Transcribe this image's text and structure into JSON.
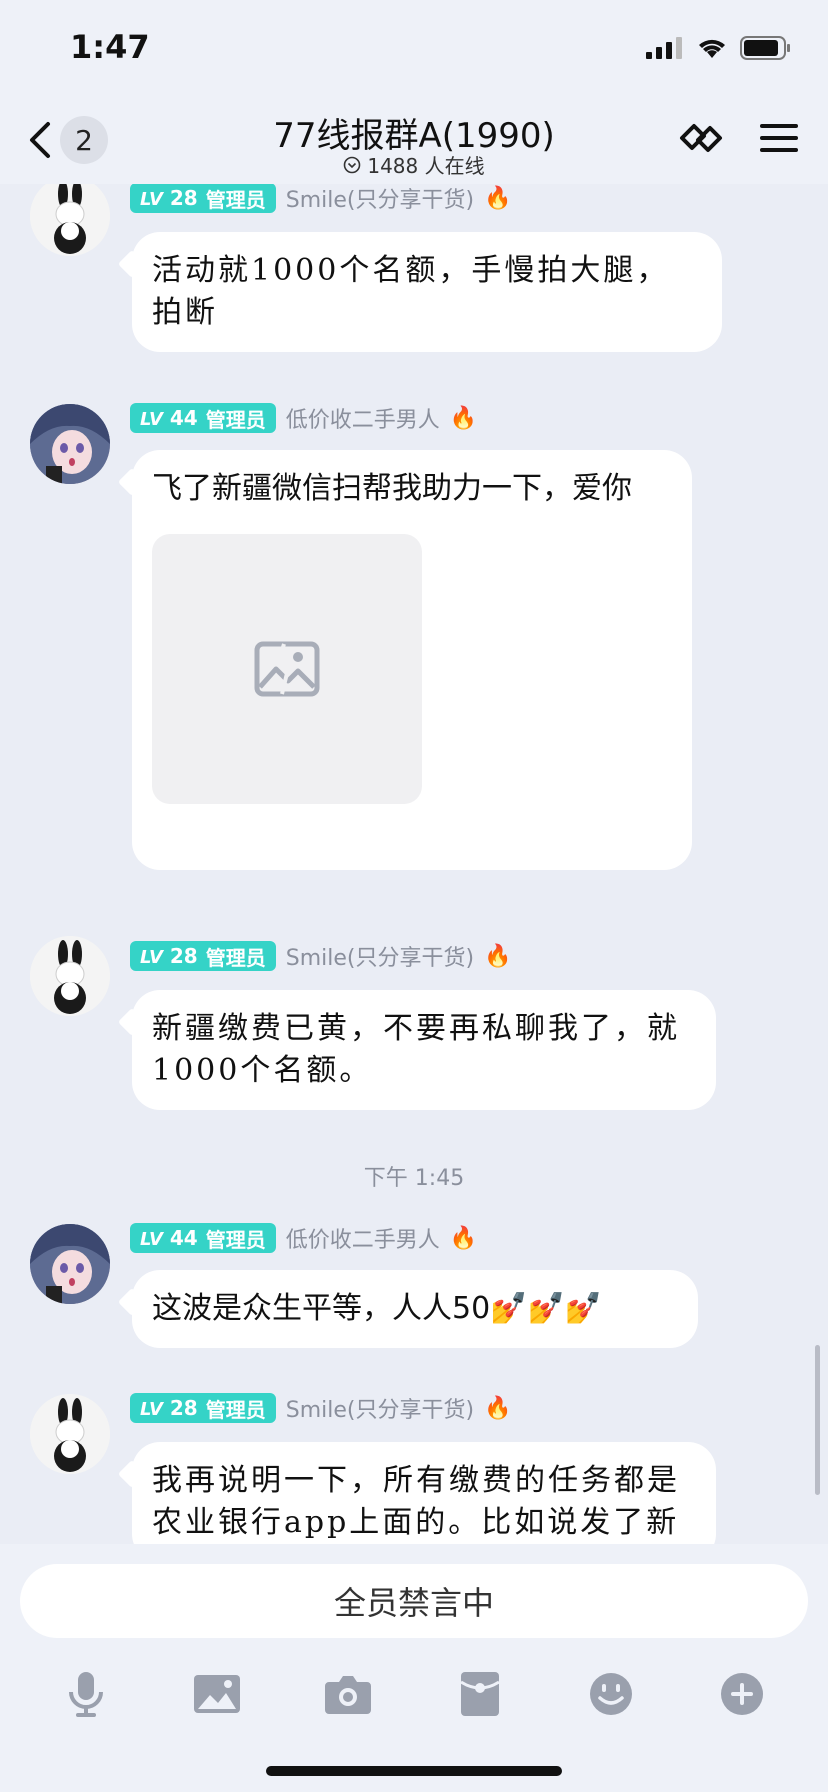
{
  "status": {
    "time": "1:47"
  },
  "nav": {
    "back_count": "2",
    "title": "77线报群A(1990)",
    "online": "1488 人在线"
  },
  "messages": [
    {
      "level": "LV",
      "level_num": "28",
      "role": "管理员",
      "sender": "Smile(只分享干货)",
      "text": "活动就1000个名额，手慢拍大腿，拍断"
    },
    {
      "level": "LV",
      "level_num": "44",
      "role": "管理员",
      "sender": "低价收二手男人",
      "text": "飞了新疆微信扫帮我助力一下，爱你"
    },
    {
      "level": "LV",
      "level_num": "28",
      "role": "管理员",
      "sender": "Smile(只分享干货)",
      "text": "新疆缴费已黄，不要再私聊我了，就1000个名额。"
    },
    {
      "level": "LV",
      "level_num": "44",
      "role": "管理员",
      "sender": "低价收二手男人",
      "text": "这波是众生平等，人人50💅💅💅"
    },
    {
      "level": "LV",
      "level_num": "28",
      "role": "管理员",
      "sender": "Smile(只分享干货)",
      "text": "我再说明一下，所有缴费的任务都是农业银行app上面的。比如说发了新"
    }
  ],
  "timestamp": "下午 1:45",
  "input": {
    "muted_text": "全员禁言中"
  },
  "toolbar": [
    "microphone-icon",
    "image-icon",
    "camera-icon",
    "redpacket-icon",
    "emoji-icon",
    "plus-icon"
  ],
  "colors": {
    "level_badge": "#35d3c7",
    "background": "#eaedf5"
  }
}
